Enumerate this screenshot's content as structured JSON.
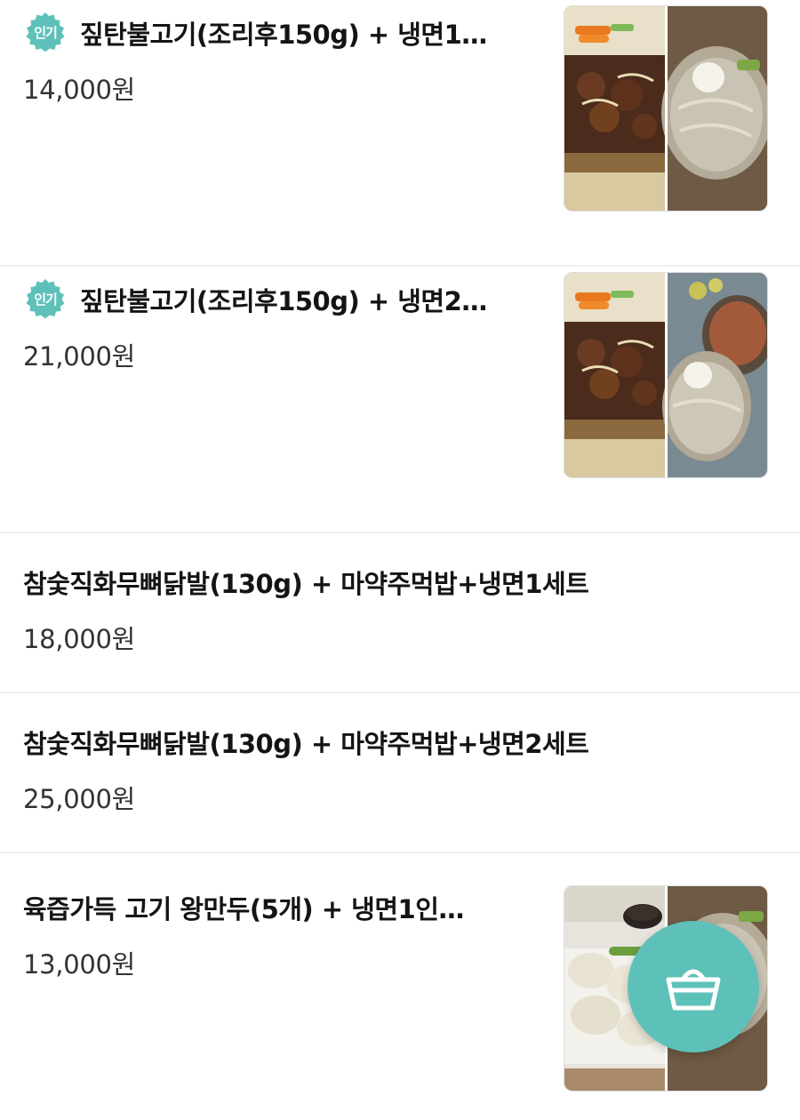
{
  "menu": {
    "items": [
      {
        "badge": "인기",
        "title": "짚탄불고기(조리후150g) + 냉면1…",
        "price": "14,000원",
        "image": "bulgogi-naengmyeon-1-photo"
      },
      {
        "badge": "인기",
        "title": "짚탄불고기(조리후150g) + 냉면2…",
        "price": "21,000원",
        "image": "bulgogi-naengmyeon-2-photo"
      },
      {
        "title": "참숯직화무뼈닭발(130g)  + 마약주먹밥+냉면1세트",
        "price": "18,000원"
      },
      {
        "title": "참숯직화무뼈닭발(130g) + 마약주먹밥+냉면2세트",
        "price": "25,000원"
      },
      {
        "title": "육즙가득 고기 왕만두(5개) + 냉면1인…",
        "price": "13,000원",
        "image": "mandu-naengmyeon-photo"
      }
    ]
  },
  "cart_button": {
    "icon": "shopping-basket-icon"
  },
  "colors": {
    "badge": "#5ec1b9",
    "fab": "#5ec1b9",
    "divider": "#eeeeee",
    "title_text": "#141414",
    "price_text": "#333333"
  }
}
